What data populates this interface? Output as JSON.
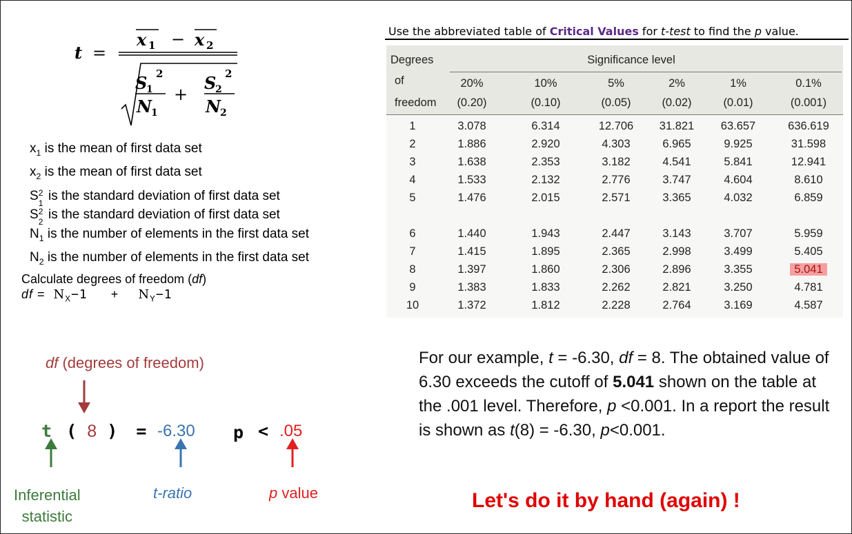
{
  "formula": {
    "t": "t",
    "equals": "=",
    "x1": "x",
    "x1_sub": "1",
    "minus": "−",
    "x2": "x",
    "x2_sub": "2",
    "s1": "S",
    "s1_sub": "1",
    "s1_sup": "2",
    "n1": "N",
    "n1_sub": "1",
    "plus": "+",
    "s2": "S",
    "s2_sub": "2",
    "s2_sup": "2",
    "n2": "N",
    "n2_sub": "2"
  },
  "definitions": [
    {
      "sym": "x",
      "sub": "1",
      "sup": "",
      "text": " is the mean of first data set"
    },
    {
      "sym": "x",
      "sub": "2",
      "sup": "",
      "text": " is the mean of first data set"
    },
    {
      "sym": "S",
      "sub": "1",
      "sup": "2",
      "text": " is the standard deviation of first data set"
    },
    {
      "sym": "S",
      "sub": "2",
      "sup": "2",
      "text": " is the standard deviation of first data set"
    },
    {
      "sym": "N",
      "sub": "1",
      "sup": "",
      "text": " is the number of elements in the first data set"
    },
    {
      "sym": "N",
      "sub": "2",
      "sup": "",
      "text": " is the number of elements in the first data set"
    }
  ],
  "df_calc": {
    "label_pre": "Calculate degrees of freedom (",
    "label_df": "df",
    "label_post": ")",
    "eq_df": "df",
    "eq_equals": " = ",
    "eq_nx": "N",
    "eq_nx_sub": "X",
    "eq_minus1": "−1",
    "eq_plus": "+",
    "eq_ny": "N",
    "eq_ny_sub": "Y",
    "eq_minus2": "−1"
  },
  "table_title": {
    "pre": "Use the abbreviated table of ",
    "link": "Critical Values",
    "mid": " for ",
    "ttest": "t-test",
    "mid2": " to find the ",
    "p": "p",
    "post": " value."
  },
  "table": {
    "deg_label": "Degrees",
    "of_label": "of",
    "freedom_label": "freedom",
    "sig_label": "Significance level",
    "columns": [
      {
        "pct": "20%",
        "dec": "(0.20)"
      },
      {
        "pct": "10%",
        "dec": "(0.10)"
      },
      {
        "pct": "5%",
        "dec": "(0.05)"
      },
      {
        "pct": "2%",
        "dec": "(0.02)"
      },
      {
        "pct": "1%",
        "dec": "(0.01)"
      },
      {
        "pct": "0.1%",
        "dec": "(0.001)"
      }
    ],
    "rows": [
      {
        "df": "1",
        "v": [
          "3.078",
          "6.314",
          "12.706",
          "31.821",
          "63.657",
          "636.619"
        ]
      },
      {
        "df": "2",
        "v": [
          "1.886",
          "2.920",
          "4.303",
          "6.965",
          "9.925",
          "31.598"
        ]
      },
      {
        "df": "3",
        "v": [
          "1.638",
          "2.353",
          "3.182",
          "4.541",
          "5.841",
          "12.941"
        ]
      },
      {
        "df": "4",
        "v": [
          "1.533",
          "2.132",
          "2.776",
          "3.747",
          "4.604",
          "8.610"
        ]
      },
      {
        "df": "5",
        "v": [
          "1.476",
          "2.015",
          "2.571",
          "3.365",
          "4.032",
          "6.859"
        ]
      },
      {
        "df": "6",
        "v": [
          "1.440",
          "1.943",
          "2.447",
          "3.143",
          "3.707",
          "5.959"
        ]
      },
      {
        "df": "7",
        "v": [
          "1.415",
          "1.895",
          "2.365",
          "2.998",
          "3.499",
          "5.405"
        ]
      },
      {
        "df": "8",
        "v": [
          "1.397",
          "1.860",
          "2.306",
          "2.896",
          "3.355",
          "5.041"
        ]
      },
      {
        "df": "9",
        "v": [
          "1.383",
          "1.833",
          "2.262",
          "2.821",
          "3.250",
          "4.781"
        ]
      },
      {
        "df": "10",
        "v": [
          "1.372",
          "1.812",
          "2.228",
          "2.764",
          "3.169",
          "4.587"
        ]
      }
    ],
    "highlight": {
      "row": 7,
      "col": 5,
      "color": "#f4a0a0"
    }
  },
  "annotation": {
    "df_label_df": "df",
    "df_label_rest": " (degrees of freedom)",
    "t": "t",
    "lparen": "(",
    "df_value": "8",
    "rparen": ")",
    "equals": "=",
    "t_value": "-6.30",
    "p": "p",
    "lt": "<",
    "p_value": ".05",
    "inferential_line1": "Inferential",
    "inferential_line2": "statistic",
    "t_ratio": "t-ratio",
    "p_value_label_p": "p",
    "p_value_label_rest": " value",
    "colors": {
      "df": "#a33b3b",
      "green": "#3d7a3d",
      "blue": "#3a74b0",
      "red": "#e02020"
    }
  },
  "paragraph": {
    "s1": "For our example, ",
    "t1": "t",
    "s2": " = -6.30, ",
    "df": "df",
    "s3": " = 8. The obtained value of 6.30 exceeds the cutoff of ",
    "bold": "5.041",
    "s4": " shown on the table at the .001 level. Therefore, ",
    "p1": "p",
    "s5": " <0.001. In a report the result is shown as ",
    "t2": "t",
    "s6": "(8) = -6.30, ",
    "p2": "p",
    "s7": "<0.001."
  },
  "cta": "Let's do it by hand (again) !"
}
